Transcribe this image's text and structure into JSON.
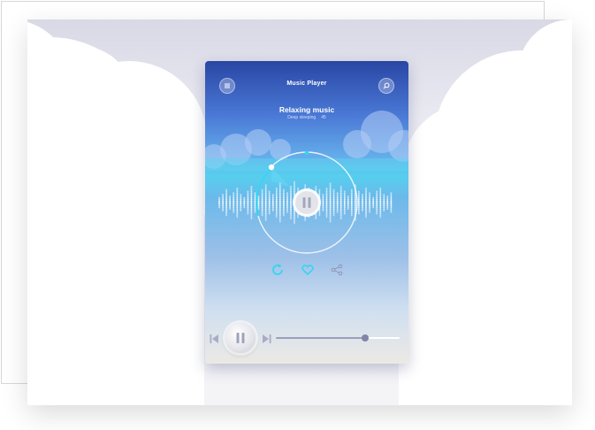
{
  "app": {
    "title": "Music Player"
  },
  "track": {
    "title": "Relaxing music",
    "subtitle": "Deep sleeping",
    "subtitle_extra": "45"
  },
  "playback": {
    "state": "paused",
    "progress": 0.72
  },
  "icons": {
    "menu": "menu-icon",
    "search": "search-icon",
    "repeat": "repeat-icon",
    "favorite": "heart-icon",
    "share": "share-icon",
    "previous": "skip-previous-icon",
    "next": "skip-next-icon",
    "pause": "pause-icon"
  },
  "colors": {
    "accent": "#33d6f0",
    "sky_top": "#2a46a4",
    "sky_bottom": "#ece9e4"
  }
}
